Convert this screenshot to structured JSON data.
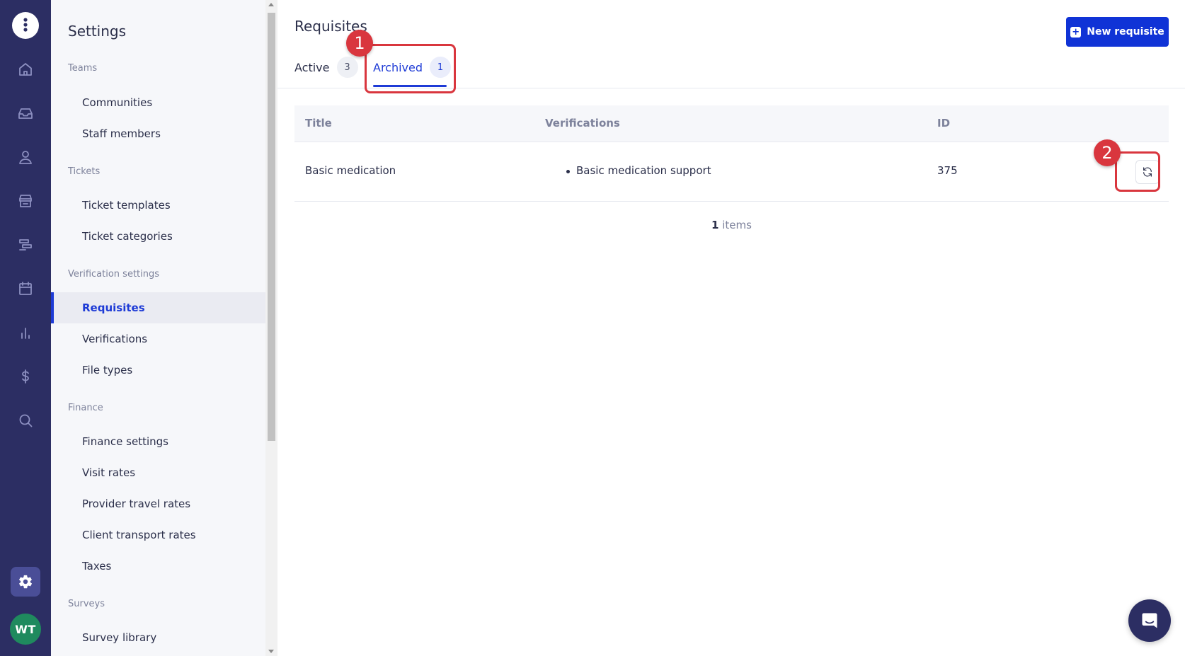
{
  "rail": {
    "avatar_initials": "WT",
    "icons": [
      "home-icon",
      "inbox-icon",
      "user-icon",
      "store-icon",
      "roadmap-icon",
      "calendar-icon",
      "chart-icon",
      "dollar-icon",
      "search-icon"
    ],
    "active": "gear-icon"
  },
  "sidebar": {
    "title": "Settings",
    "sections": {
      "teams": "Teams",
      "tickets": "Tickets",
      "verification": "Verification settings",
      "finance": "Finance",
      "surveys": "Surveys"
    },
    "items": {
      "communities": "Communities",
      "staff_members": "Staff members",
      "ticket_templates": "Ticket templates",
      "ticket_categories": "Ticket categories",
      "requisites": "Requisites",
      "verifications": "Verifications",
      "file_types": "File types",
      "finance_settings": "Finance settings",
      "visit_rates": "Visit rates",
      "provider_travel_rates": "Provider travel rates",
      "client_transport_rates": "Client transport rates",
      "taxes": "Taxes",
      "survey_library": "Survey library"
    },
    "active_item": "Requisites"
  },
  "main": {
    "title": "Requisites",
    "new_button": "New requisite",
    "tabs": [
      {
        "label": "Active",
        "count": "3"
      },
      {
        "label": "Archived",
        "count": "1"
      }
    ],
    "active_tab": "Archived",
    "table": {
      "headers": {
        "title": "Title",
        "verifications": "Verifications",
        "id": "ID"
      },
      "rows": [
        {
          "title": "Basic medication",
          "verifications": [
            "Basic medication support"
          ],
          "id": "375"
        }
      ]
    },
    "footer": {
      "count": "1",
      "suffix": "items"
    }
  },
  "annotations": {
    "one": "1",
    "two": "2"
  },
  "colors": {
    "rail_bg": "#2c2e63",
    "accent": "#1e3bd6",
    "primary_button": "#1033d6",
    "annotation": "#d9363e"
  }
}
